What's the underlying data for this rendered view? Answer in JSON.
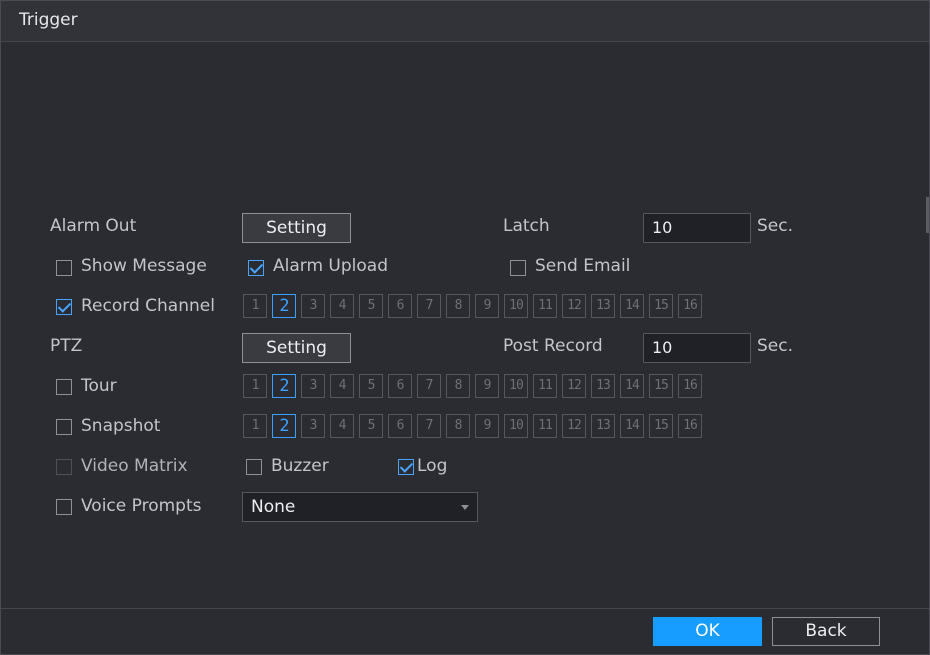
{
  "window": {
    "title": "Trigger"
  },
  "alarm_out": {
    "label": "Alarm Out",
    "button_label": "Setting"
  },
  "latch": {
    "label": "Latch",
    "value": "10",
    "unit": "Sec."
  },
  "show_message": {
    "label": "Show Message",
    "checked": false
  },
  "alarm_upload": {
    "label": "Alarm Upload",
    "checked": true
  },
  "send_email": {
    "label": "Send Email",
    "checked": false
  },
  "record_channel": {
    "label": "Record Channel",
    "checked": true,
    "selected_channel": 2
  },
  "ptz": {
    "label": "PTZ",
    "button_label": "Setting"
  },
  "post_record": {
    "label": "Post Record",
    "value": "10",
    "unit": "Sec."
  },
  "tour": {
    "label": "Tour",
    "checked": false,
    "selected_channel": 2
  },
  "snapshot": {
    "label": "Snapshot",
    "checked": false,
    "selected_channel": 2
  },
  "video_matrix": {
    "label": "Video Matrix",
    "checked": false,
    "disabled": true
  },
  "buzzer": {
    "label": "Buzzer",
    "checked": false
  },
  "log": {
    "label": "Log",
    "checked": true
  },
  "voice_prompts": {
    "label": "Voice Prompts",
    "checked": false,
    "selected_value": "None"
  },
  "channels": [
    "1",
    "2",
    "3",
    "4",
    "5",
    "6",
    "7",
    "8",
    "9",
    "10",
    "11",
    "12",
    "13",
    "14",
    "15",
    "16"
  ],
  "footer": {
    "ok_label": "OK",
    "back_label": "Back"
  },
  "colors": {
    "accent": "#179cff",
    "background": "#2b2c31",
    "selected_channel": "#3aa0ff"
  }
}
